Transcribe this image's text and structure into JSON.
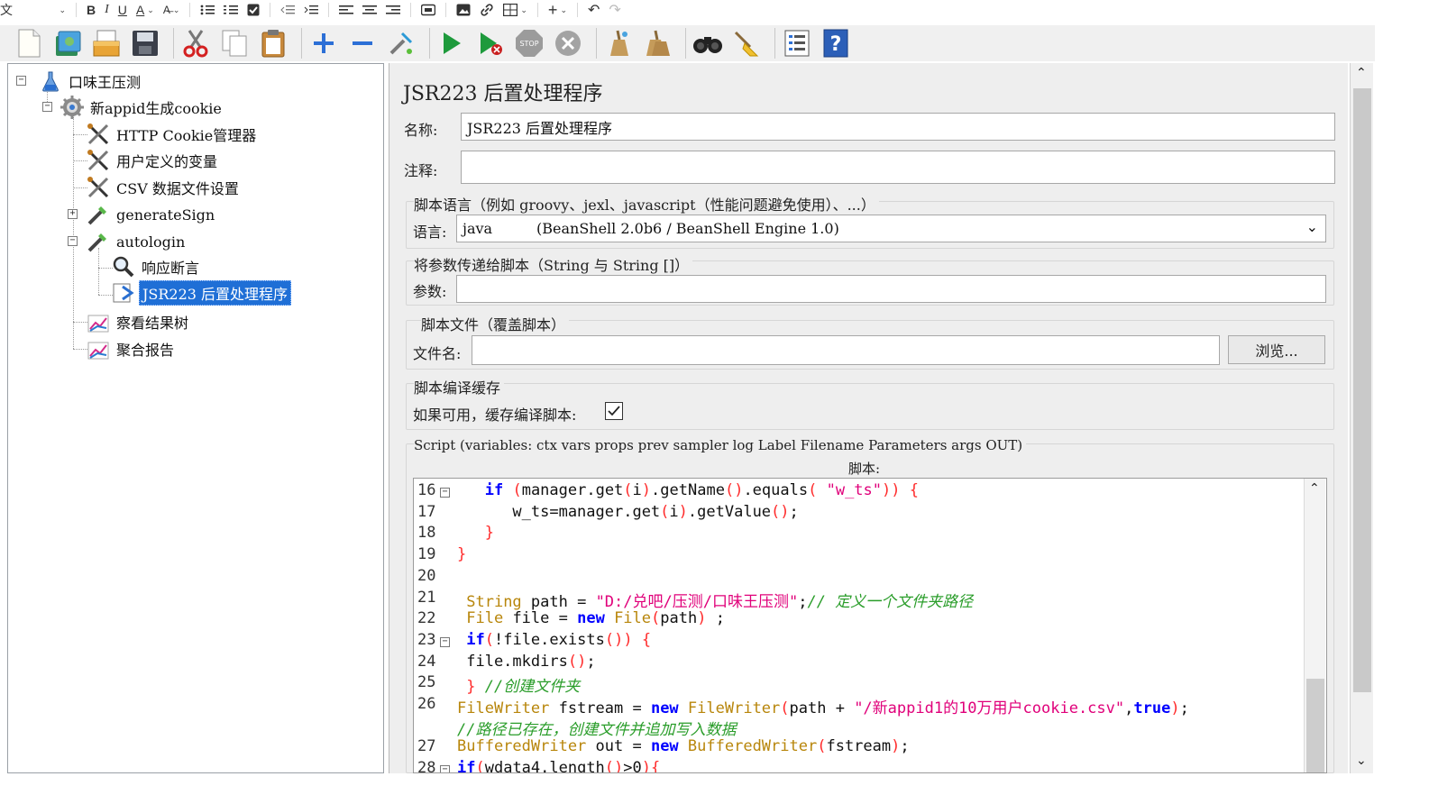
{
  "topbar": {
    "first_label": "文",
    "buttons": [
      "B",
      "I",
      "U",
      "A",
      "A̶"
    ],
    "icons": [
      "bullet-list-icon",
      "numbered-list-icon",
      "checkbox-icon",
      "outdent-icon",
      "indent-icon",
      "align-left-icon",
      "align-center-icon",
      "align-right-icon",
      "embed-icon",
      "image-icon",
      "link-icon",
      "table-icon",
      "insert-icon",
      "undo-icon",
      "redo-icon"
    ]
  },
  "toolbar": {
    "icons": [
      "new-icon",
      "templates-icon",
      "open-icon",
      "save-icon",
      "cut-icon",
      "copy-icon",
      "paste-icon",
      "expand-icon",
      "collapse-icon",
      "toggle-icon",
      "start-icon",
      "start-no-pause-icon",
      "stop-icon",
      "shutdown-icon",
      "clear-icon",
      "clear-all-icon",
      "search-icon",
      "reset-search-icon",
      "function-helper-icon",
      "help-icon"
    ]
  },
  "tree": {
    "nodes": [
      {
        "label": "口味王压测",
        "level": 0,
        "expander": "−",
        "icon": "test-plan-icon"
      },
      {
        "label": "新appid生成cookie",
        "level": 1,
        "expander": "−",
        "icon": "thread-group-icon"
      },
      {
        "label": "HTTP Cookie管理器",
        "level": 2,
        "expander": "",
        "icon": "config-element-icon"
      },
      {
        "label": "用户定义的变量",
        "level": 2,
        "expander": "",
        "icon": "config-element-icon"
      },
      {
        "label": "CSV 数据文件设置",
        "level": 2,
        "expander": "",
        "icon": "config-element-icon"
      },
      {
        "label": "generateSign",
        "level": 2,
        "expander": "+",
        "icon": "sampler-icon"
      },
      {
        "label": "autologin",
        "level": 2,
        "expander": "−",
        "icon": "sampler-icon"
      },
      {
        "label": "响应断言",
        "level": 3,
        "expander": "",
        "icon": "assertion-icon"
      },
      {
        "label": "JSR223 后置处理程序",
        "level": 3,
        "expander": "",
        "icon": "postprocessor-icon",
        "selected": true
      },
      {
        "label": "察看结果树",
        "level": 2,
        "expander": "",
        "icon": "listener-icon"
      },
      {
        "label": "聚合报告",
        "level": 2,
        "expander": "",
        "icon": "listener-icon"
      }
    ]
  },
  "panel": {
    "title": "JSR223 后置处理程序",
    "name_label": "名称:",
    "name_value": "JSR223 后置处理程序",
    "comment_label": "注释:",
    "comment_value": "",
    "lang_group": "脚本语言（例如 groovy、jexl、javascript（性能问题避免使用）、...）",
    "lang_label": "语言:",
    "lang_value": "java",
    "lang_engine": "(BeanShell 2.0b6 / BeanShell Engine 1.0)",
    "params_group": "将参数传递给脚本（String 与 String []）",
    "params_label": "参数:",
    "params_value": "",
    "file_group": "脚本文件（覆盖脚本）",
    "file_label": "文件名:",
    "file_value": "",
    "browse_label": "浏览...",
    "cache_group": "脚本编译缓存",
    "cache_label": "如果可用，缓存编译脚本:",
    "cache_checked": true,
    "script_group": "Script (variables: ctx vars props prev sampler log Label Filename Parameters args OUT)",
    "script_label": "脚本:"
  },
  "code": {
    "line_numbers": [
      "16",
      "17",
      "18",
      "19",
      "20",
      "21",
      "22",
      "23",
      "24",
      "25",
      "26",
      "",
      "27",
      "28"
    ],
    "fold_lines": [
      "16",
      "23",
      "28"
    ],
    "lines": [
      "   if (manager.get(i).getName().equals( \"w_ts\")) {",
      "      w_ts=manager.get(i).getValue();",
      "   }",
      "}",
      "",
      " String path = \"D:/兑吧/压测/口味王压测\";// 定义一个文件夹路径",
      " File file = new File(path) ;",
      " if(!file.exists()) {",
      " file.mkdirs();",
      " } //创建文件夹",
      "FileWriter fstream = new FileWriter(path + \"/新appid1的10万用户cookie.csv\",true);",
      "//路径已存在，创建文件并追加写入数据",
      "BufferedWriter out = new BufferedWriter(fstream);",
      "if(wdata4.length()>0){"
    ]
  }
}
